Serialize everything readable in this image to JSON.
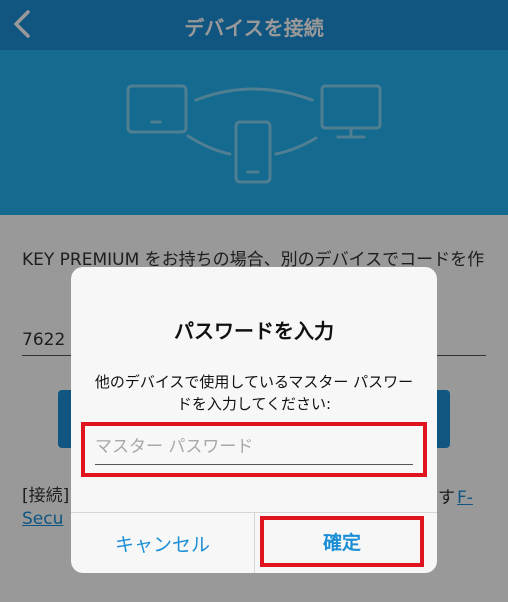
{
  "navbar": {
    "title": "デバイスを接続",
    "back_icon": "chevron-left-icon"
  },
  "hero": {
    "illustration": "connected-devices-illustration"
  },
  "content": {
    "description": "KEY PREMIUM をお持ちの場合、別のデバイスでコードを作",
    "code_value": "7622",
    "footer_start": "[接続]",
    "footer_mid": "す",
    "footer_link_1": "F-",
    "footer_link_2": "Secu"
  },
  "dialog": {
    "title": "パスワードを入力",
    "message": "他のデバイスで使用しているマスター パスワードを入力してください:",
    "input_placeholder": "マスター パスワード",
    "input_value": "",
    "cancel_label": "キャンセル",
    "confirm_label": "確定"
  },
  "colors": {
    "nav_bar": "#1b8fd6",
    "hero": "#23b3ee",
    "accent": "#1b8fd6",
    "highlight": "#e0141e"
  }
}
